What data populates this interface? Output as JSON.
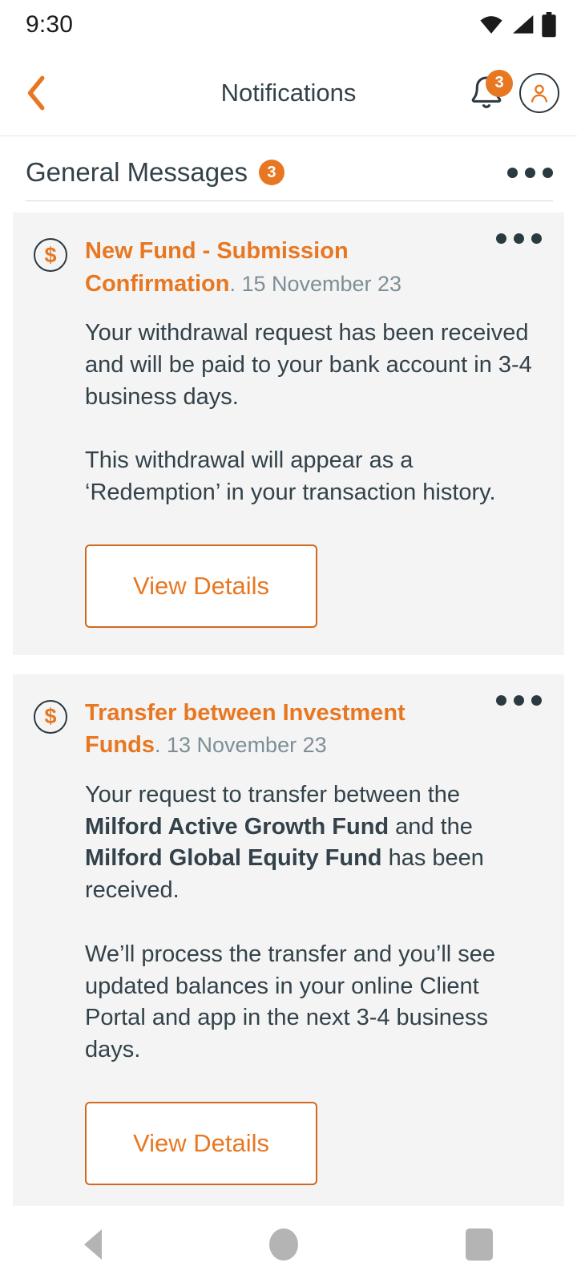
{
  "status_bar": {
    "time": "9:30",
    "icons": [
      "wifi-icon",
      "cellular-signal-icon",
      "battery-icon"
    ]
  },
  "app_bar": {
    "back_icon": "chevron-left-icon",
    "title": "Notifications",
    "bell_icon": "bell-icon",
    "bell_badge": "3",
    "avatar_icon": "user-avatar-icon"
  },
  "section": {
    "title": "General Messages",
    "badge": "3",
    "overflow_icon": "more-options-icon"
  },
  "notifications": [
    {
      "icon": "dollar-coin-icon",
      "title": "New Fund - Submission Confirmation",
      "separator": ".",
      "date": "15 November 23",
      "paragraphs": [
        {
          "parts": [
            {
              "text": "Your withdrawal request has been received and will be paid to your bank account in 3-4 business days.",
              "bold": false
            }
          ]
        },
        {
          "parts": [
            {
              "text": "This withdrawal will appear as a ‘Redemption’ in your transaction history.",
              "bold": false
            }
          ]
        }
      ],
      "button_label": "View Details",
      "overflow_icon": "more-options-icon"
    },
    {
      "icon": "dollar-coin-icon",
      "title": "Transfer between Investment Funds",
      "separator": ".",
      "date": "13 November 23",
      "paragraphs": [
        {
          "parts": [
            {
              "text": "Your request to transfer between the ",
              "bold": false
            },
            {
              "text": "Milford Active Growth Fund",
              "bold": true
            },
            {
              "text": " and the ",
              "bold": false
            },
            {
              "text": "Milford Global Equity Fund",
              "bold": true
            },
            {
              "text": " has been received.",
              "bold": false
            }
          ]
        },
        {
          "parts": [
            {
              "text": "We’ll process the transfer and you’ll see updated balances in your online Client Portal and app in the next 3-4 business days.",
              "bold": false
            }
          ]
        }
      ],
      "button_label": "View Details",
      "overflow_icon": "more-options-icon"
    }
  ],
  "nav_bar": {
    "back_icon": "nav-back-icon",
    "home_icon": "nav-home-icon",
    "recents_icon": "nav-recents-icon"
  },
  "colors": {
    "accent_orange": "#E87722",
    "button_border": "#D2691E",
    "text_dark": "#33424a",
    "date_gray": "#7d8f96",
    "card_bg": "#f4f4f4"
  }
}
